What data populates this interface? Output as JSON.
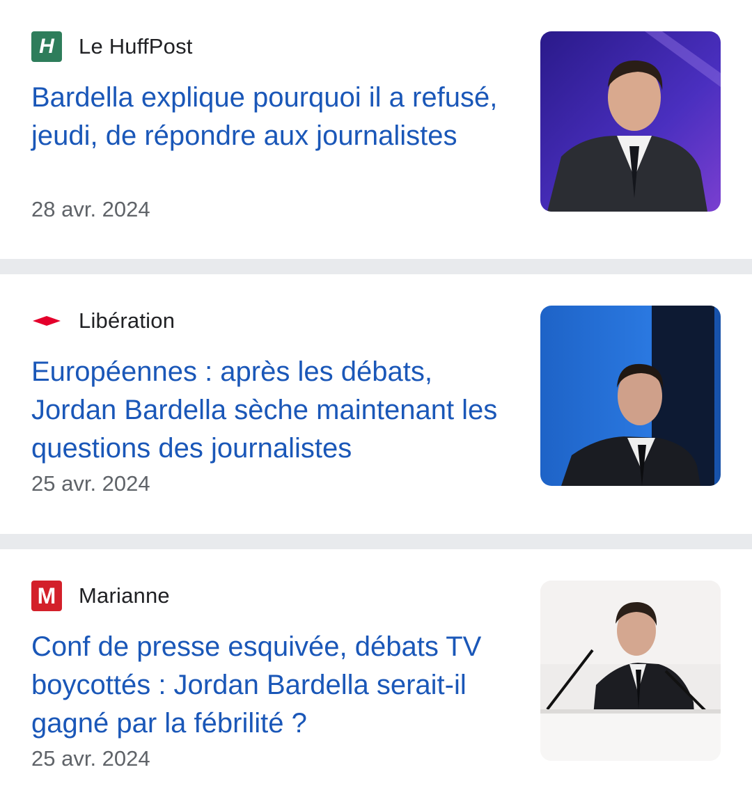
{
  "articles": [
    {
      "source": "Le HuffPost",
      "logo_letter": "H",
      "headline": "Bardella explique pourquoi il a refusé, jeudi, de répondre aux journalistes",
      "date": "28 avr. 2024",
      "logo_color": "#2e7d5b"
    },
    {
      "source": "Libération",
      "headline": "Européennes : après les débats, Jordan Bardella sèche maintenant les questions des journalistes",
      "date": "25 avr. 2024",
      "logo_color": "#e4002b"
    },
    {
      "source": "Marianne",
      "logo_letter": "M",
      "headline": "Conf de presse esquivée, débats TV boycottés : Jordan Bardella serait-il gagné par la fébrilité ?",
      "date": "25 avr. 2024",
      "logo_color": "#d3202a"
    }
  ],
  "colors": {
    "headline": "#1a57b8",
    "source_text": "#202124",
    "date_text": "#5f6368",
    "separator": "#e8eaed"
  }
}
